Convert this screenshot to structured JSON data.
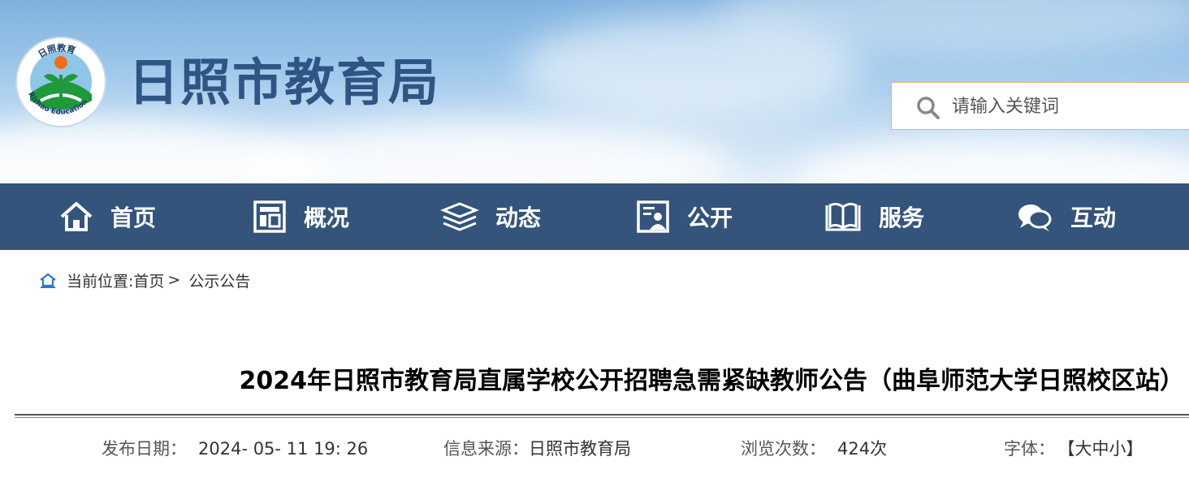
{
  "header": {
    "site_name": "日照市教育局",
    "logo": {
      "text_top": "日照教育",
      "text_bottom": "Rizhao Education"
    },
    "search": {
      "placeholder": "请输入关键词",
      "icon": "search-icon"
    }
  },
  "nav": {
    "items": [
      {
        "label": "首页",
        "icon": "home-icon"
      },
      {
        "label": "概况",
        "icon": "overview-icon"
      },
      {
        "label": "动态",
        "icon": "news-stack-icon"
      },
      {
        "label": "公开",
        "icon": "public-info-icon"
      },
      {
        "label": "服务",
        "icon": "book-icon"
      },
      {
        "label": "互动",
        "icon": "chat-icon"
      }
    ]
  },
  "breadcrumb": {
    "prefix": "当前位置: ",
    "home": "首页",
    "separator": ">",
    "current": "公示公告"
  },
  "article": {
    "title": "2024年日照市教育局直属学校公开招聘急需紧缺教师公告（曲阜师范大学日照校区站）",
    "meta": {
      "date_label": "发布日期：",
      "date_value": "2024- 05- 11 19: 26",
      "source_label": "信息来源：",
      "source_value": "日照市教育局",
      "views_label": "浏览次数：",
      "views_value": "424次",
      "font_label": "字体：",
      "font_open": "【",
      "font_large": "大",
      "font_medium": "中",
      "font_small": "小",
      "font_close": "】"
    }
  },
  "colors": {
    "nav_bg": "#34547b",
    "site_name": "#2e5583",
    "search_border": "#d9b878"
  }
}
